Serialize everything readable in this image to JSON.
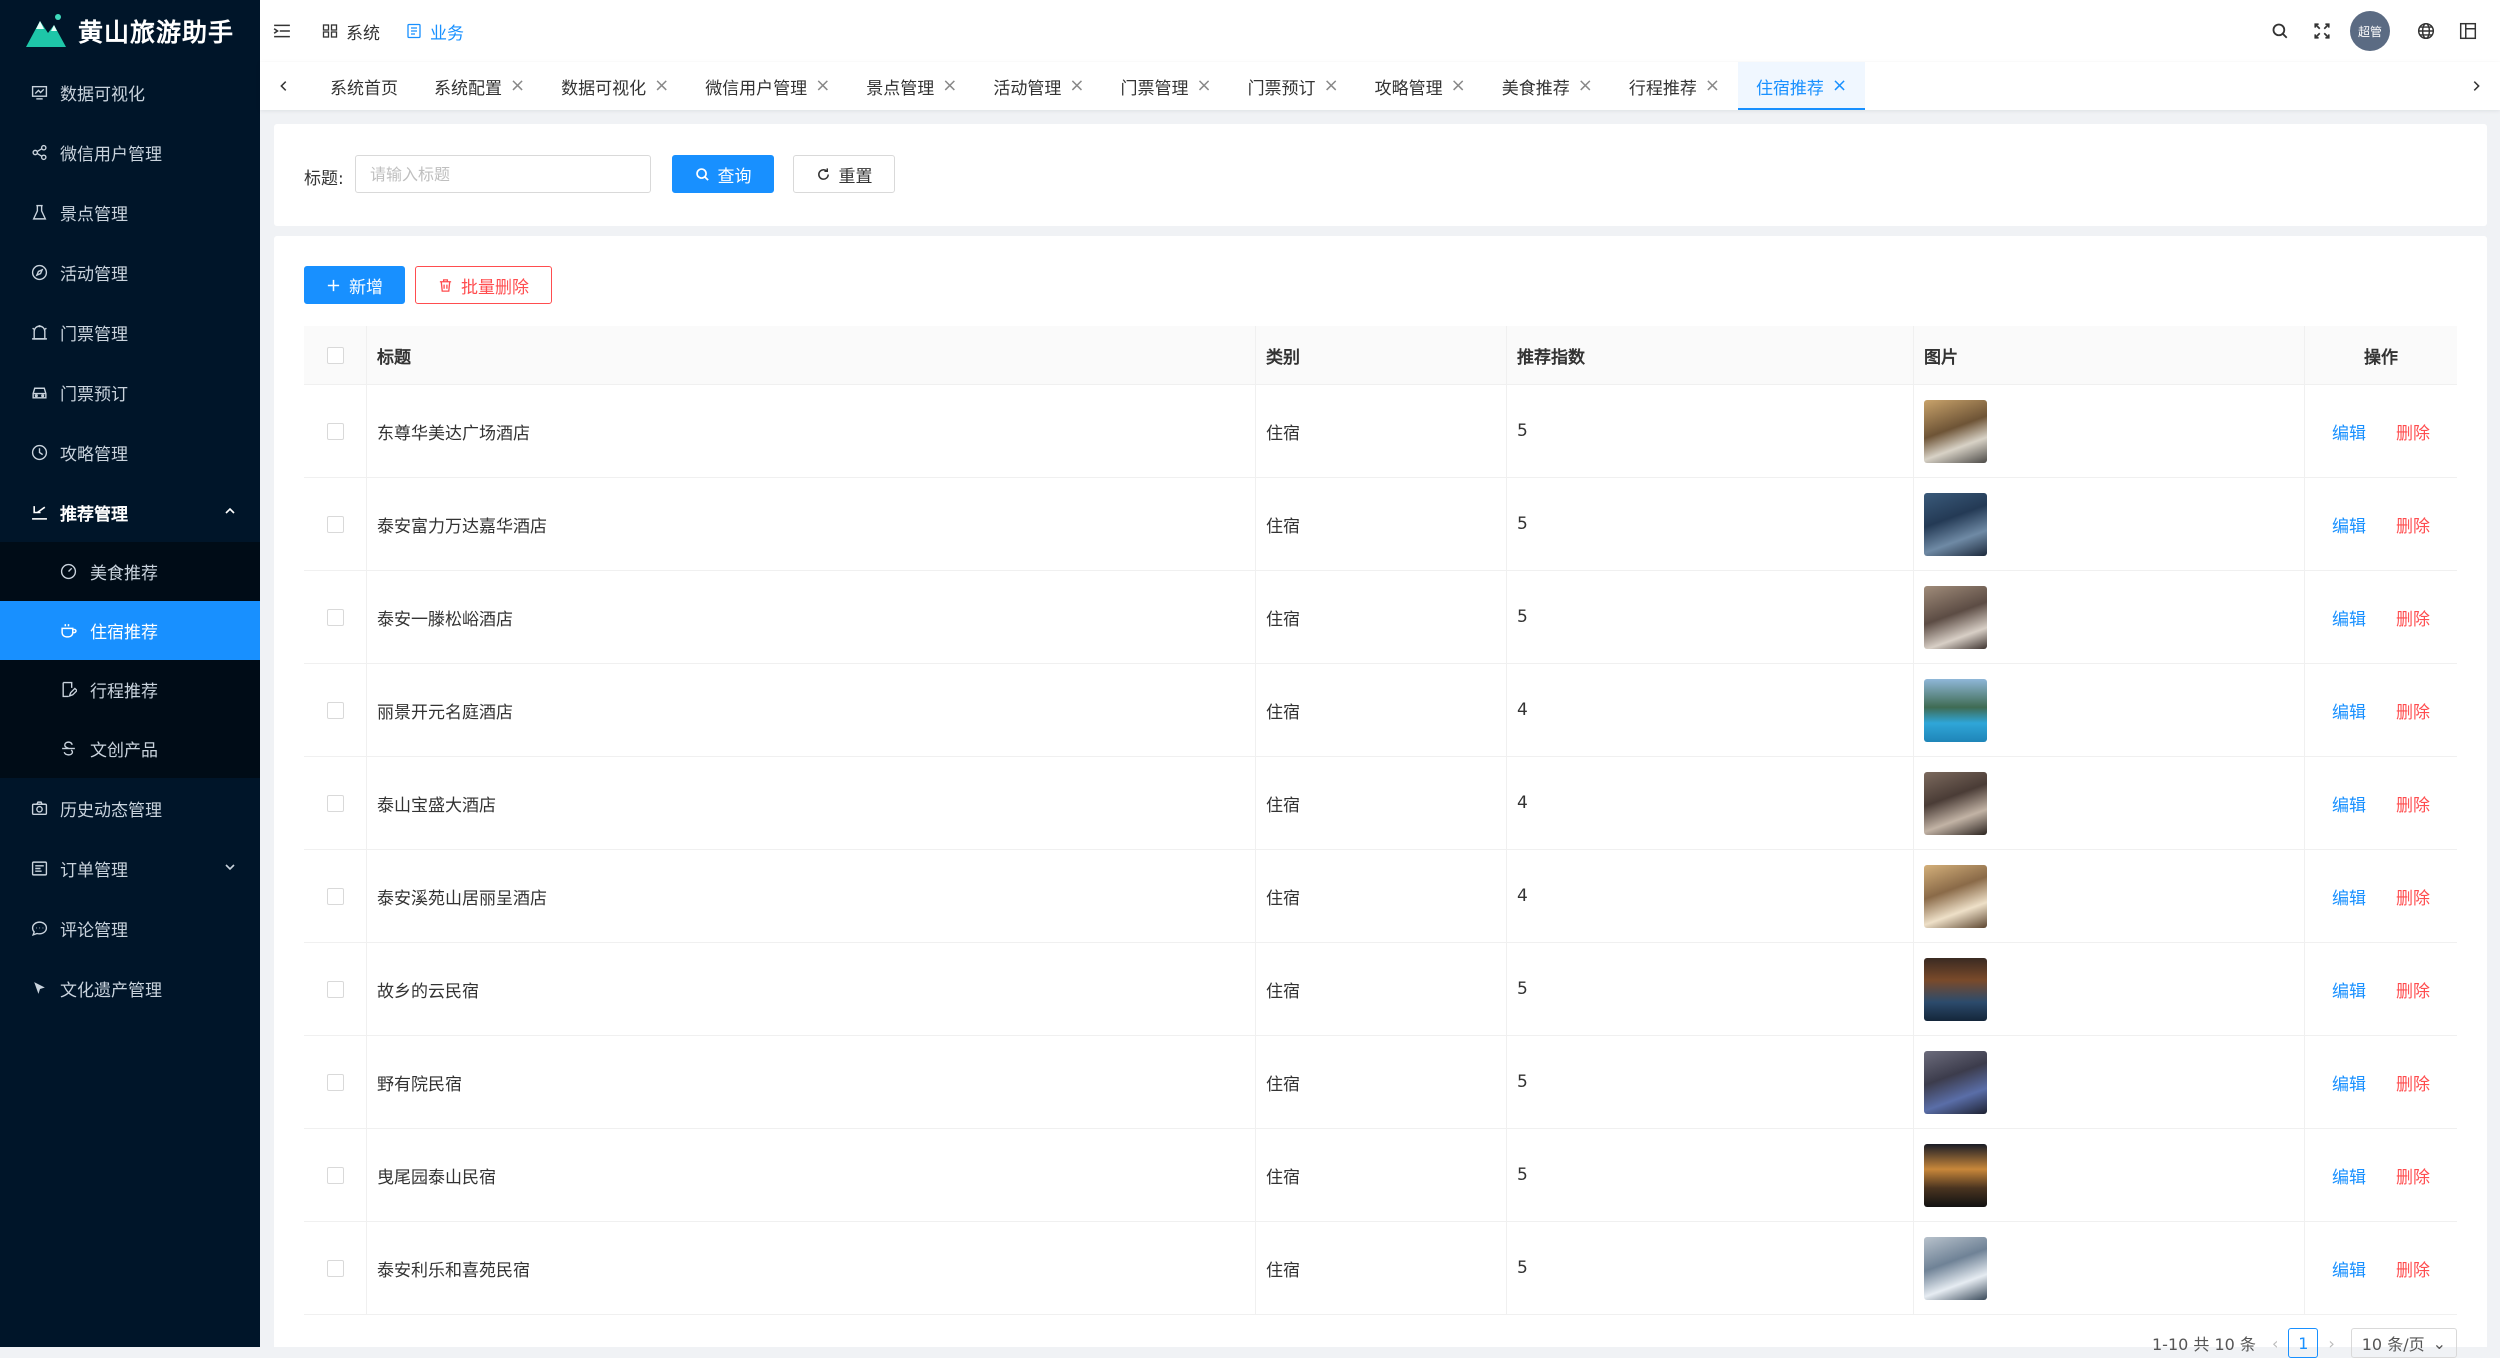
{
  "app": {
    "title": "黄山旅游助手"
  },
  "sidebar": {
    "items": [
      {
        "label": "数据可视化",
        "icon": "chart-icon"
      },
      {
        "label": "微信用户管理",
        "icon": "share-icon"
      },
      {
        "label": "景点管理",
        "icon": "flask-icon"
      },
      {
        "label": "活动管理",
        "icon": "compass-icon"
      },
      {
        "label": "门票管理",
        "icon": "ticket-icon"
      },
      {
        "label": "门票预订",
        "icon": "car-icon"
      },
      {
        "label": "攻略管理",
        "icon": "clock-icon"
      }
    ],
    "open_group": {
      "label": "推荐管理",
      "children": [
        {
          "label": "美食推荐"
        },
        {
          "label": "住宿推荐"
        },
        {
          "label": "行程推荐"
        },
        {
          "label": "文创产品"
        }
      ]
    },
    "items_after": [
      {
        "label": "历史动态管理"
      },
      {
        "label": "订单管理"
      },
      {
        "label": "评论管理"
      },
      {
        "label": "文化遗产管理"
      }
    ]
  },
  "header": {
    "menus": [
      {
        "label": "系统"
      },
      {
        "label": "业务"
      }
    ],
    "avatar_text": "超管"
  },
  "tabs": [
    {
      "label": "系统首页"
    },
    {
      "label": "系统配置"
    },
    {
      "label": "数据可视化"
    },
    {
      "label": "微信用户管理"
    },
    {
      "label": "景点管理"
    },
    {
      "label": "活动管理"
    },
    {
      "label": "门票管理"
    },
    {
      "label": "门票预订"
    },
    {
      "label": "攻略管理"
    },
    {
      "label": "美食推荐"
    },
    {
      "label": "行程推荐"
    },
    {
      "label": "住宿推荐"
    }
  ],
  "search": {
    "label": "标题:",
    "placeholder": "请输入标题",
    "query_label": "查询",
    "reset_label": "重置"
  },
  "toolbar": {
    "add_label": "新增",
    "batch_delete_label": "批量删除"
  },
  "table": {
    "columns": {
      "title": "标题",
      "category": "类别",
      "score": "推荐指数",
      "image": "图片",
      "actions": "操作"
    },
    "edit_label": "编辑",
    "delete_label": "删除",
    "rows": [
      {
        "title": "东尊华美达广场酒店",
        "category": "住宿",
        "score": "5"
      },
      {
        "title": "泰安富力万达嘉华酒店",
        "category": "住宿",
        "score": "5"
      },
      {
        "title": "泰安一滕松峪酒店",
        "category": "住宿",
        "score": "5"
      },
      {
        "title": "丽景开元名庭酒店",
        "category": "住宿",
        "score": "4"
      },
      {
        "title": "泰山宝盛大酒店",
        "category": "住宿",
        "score": "4"
      },
      {
        "title": "泰安溪苑山居丽呈酒店",
        "category": "住宿",
        "score": "4"
      },
      {
        "title": "故乡的云民宿",
        "category": "住宿",
        "score": "5"
      },
      {
        "title": "野有院民宿",
        "category": "住宿",
        "score": "5"
      },
      {
        "title": "曳尾园泰山民宿",
        "category": "住宿",
        "score": "5"
      },
      {
        "title": "泰安利乐和喜苑民宿",
        "category": "住宿",
        "score": "5"
      }
    ]
  },
  "pagination": {
    "summary": "1-10 共 10 条",
    "current": "1",
    "page_size": "10 条/页"
  },
  "colors": {
    "accent": "#1890ff",
    "danger": "#ff4d4f",
    "sidebar_bg": "#001529",
    "submenu_bg": "#000c17"
  }
}
